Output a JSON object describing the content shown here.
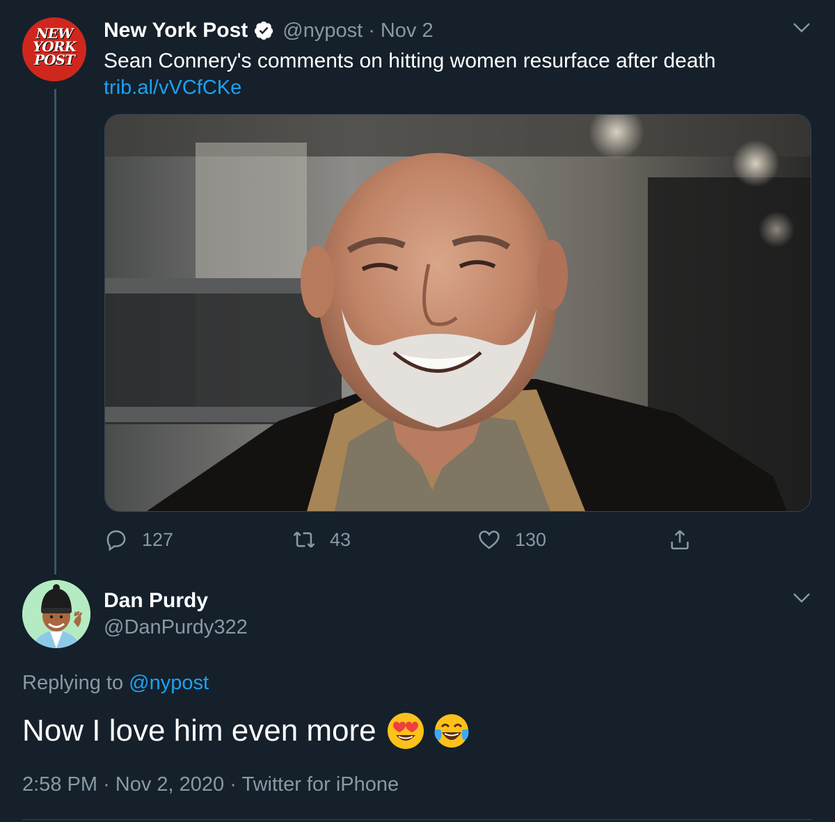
{
  "original_tweet": {
    "author_name": "New York Post",
    "handle": "@nypost",
    "separator": "·",
    "date": "Nov 2",
    "text": "Sean Connery's comments on hitting women resurface after death",
    "link": "trib.al/vVCfCKe",
    "avatar_logo": [
      "NEW",
      "YORK",
      "POST"
    ],
    "verified_icon": "verified-badge-icon",
    "media_icon": "photo",
    "actions": {
      "replies": "127",
      "retweets": "43",
      "likes": "130"
    }
  },
  "reply_tweet": {
    "author_name": "Dan Purdy",
    "handle": "@DanPurdy322",
    "replying_prefix": "Replying to",
    "replying_to": "@nypost",
    "text": "Now I love him even more",
    "emojis": [
      "heart-eyes-emoji",
      "tears-of-joy-emoji"
    ],
    "time": "2:58 PM",
    "sep": "·",
    "date": "Nov 2, 2020",
    "source": "Twitter for iPhone"
  },
  "colors": {
    "background": "#15202b",
    "text": "#ffffff",
    "muted": "#8899a6",
    "link": "#1da1f2",
    "nyp_red": "#d0271d",
    "avatar_green": "#b5ebc2"
  }
}
